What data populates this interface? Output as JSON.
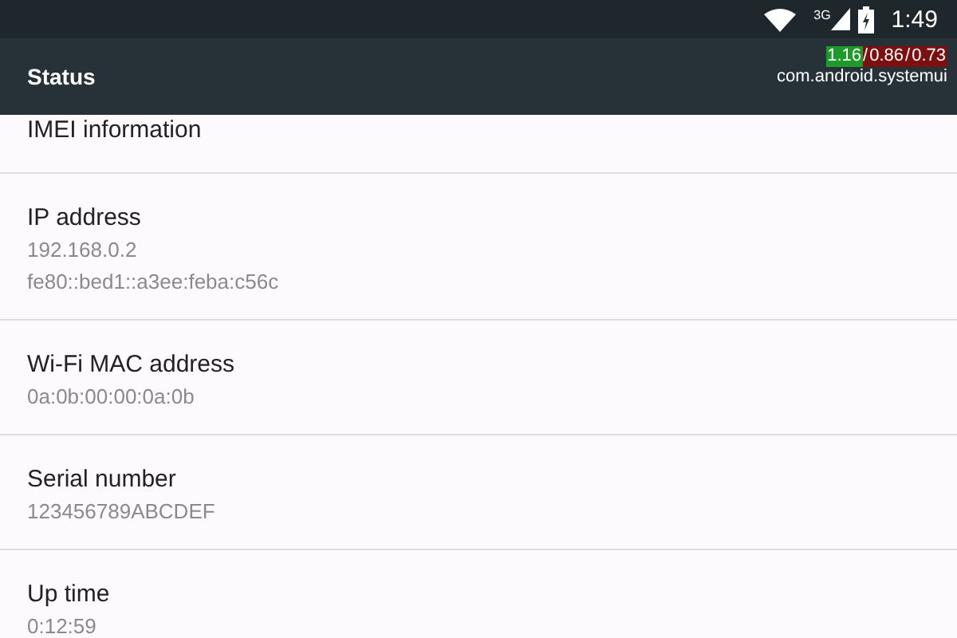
{
  "status_bar": {
    "time": "1:49",
    "network": "3G"
  },
  "toolbar": {
    "title": "Status"
  },
  "load_overlay": {
    "loads": [
      {
        "value": "1.16",
        "color": "#1e9a2a"
      },
      {
        "value": "0.86",
        "color": "#7a1010"
      },
      {
        "value": "0.73",
        "color": "#7a1010"
      }
    ],
    "separator": "/",
    "process": "com.android.systemui"
  },
  "items": [
    {
      "title": "IMEI information"
    },
    {
      "title": "IP address",
      "values": [
        "192.168.0.2",
        "fe80::bed1::a3ee:feba:c56c"
      ]
    },
    {
      "title": "Wi-Fi MAC address",
      "values": [
        "0a:0b:00:00:0a:0b"
      ]
    },
    {
      "title": "Serial number",
      "values": [
        "123456789ABCDEF"
      ]
    },
    {
      "title": "Up time",
      "values": [
        "0:12:59"
      ]
    }
  ]
}
